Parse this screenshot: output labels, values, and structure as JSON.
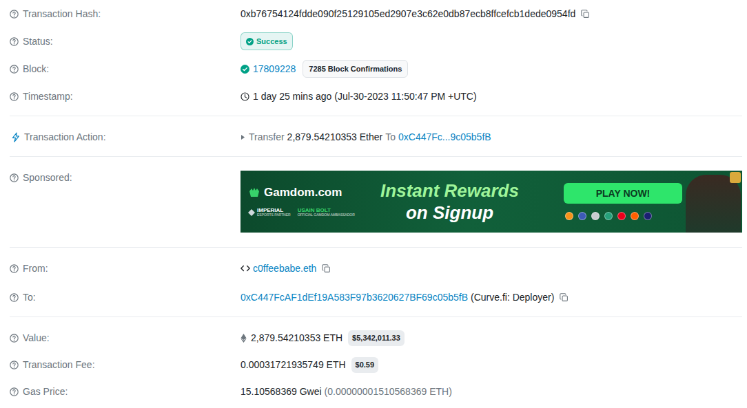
{
  "sections": [
    {
      "rows": [
        {
          "kind": "hash",
          "label": "Transaction Hash:",
          "value": "0xb76754124fdde090f25129105ed2907e3c62e0db87ecb8ffcefcb1dede0954fd"
        },
        {
          "kind": "status",
          "label": "Status:",
          "badge": "Success"
        },
        {
          "kind": "block",
          "label": "Block:",
          "value": "17809228",
          "badge": "7285 Block Confirmations"
        },
        {
          "kind": "timestamp",
          "label": "Timestamp:",
          "value": "1 day 25 mins ago (Jul-30-2023 11:50:47 PM +UTC)"
        }
      ]
    },
    {
      "rows": [
        {
          "kind": "action",
          "label": "Transaction Action:",
          "verb": "Transfer",
          "amount": "2,879.54210353 Ether",
          "to_word": "To",
          "target": "0xC447Fc...9c05b5fB"
        }
      ]
    },
    {
      "rows": [
        {
          "kind": "sponsored",
          "label": "Sponsored:",
          "ad": {
            "brand": "Gamdom.com",
            "partner_name": "IMPERIAL",
            "partner_role": "ESPORTS PARTNER",
            "ambassador_name": "USAIN BOLT",
            "ambassador_role": "OFFICIAL GAMDOM AMBASSADOR",
            "headline": "Instant Rewards",
            "subline": "on Signup",
            "button": "PLAY NOW!"
          }
        }
      ]
    },
    {
      "rows": [
        {
          "kind": "contract_address",
          "label": "From:",
          "value": "c0ffeebabe.eth"
        },
        {
          "kind": "tagged_address",
          "label": "To:",
          "value": "0xC447FcAF1dEf19A583F97b3620627BF69c05b5fB",
          "tag": "(Curve.fi: Deployer)"
        }
      ]
    },
    {
      "rows": [
        {
          "kind": "eth_amount",
          "label": "Value:",
          "value": "2,879.54210353 ETH",
          "badge": "$5,342,011.33"
        },
        {
          "kind": "amount",
          "label": "Transaction Fee:",
          "value": "0.00031721935749 ETH",
          "badge": "$0.59"
        },
        {
          "kind": "gas",
          "label": "Gas Price:",
          "value": "15.10568369 Gwei",
          "detail": "(0.00000001510568369 ETH)"
        }
      ]
    }
  ]
}
